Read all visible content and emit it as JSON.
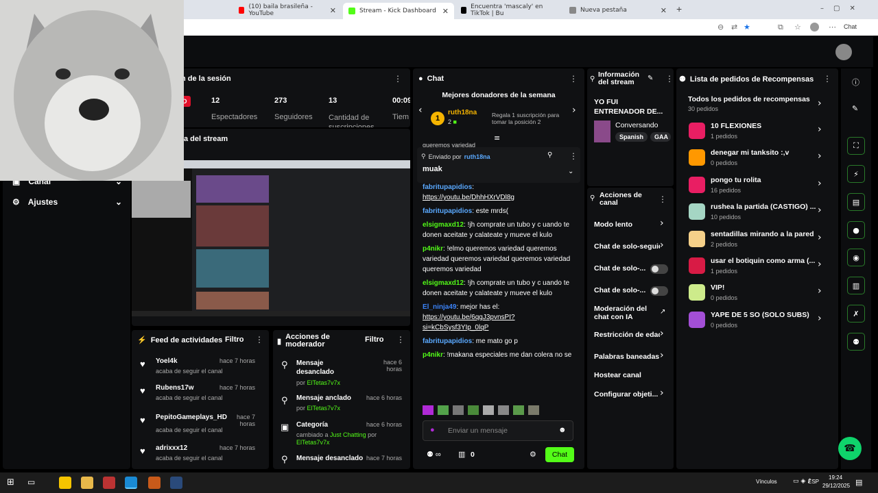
{
  "browser": {
    "tabs": [
      {
        "label": "(10) baila brasileña - YouTube",
        "color": "#ff0000",
        "active": false
      },
      {
        "label": "Stream - Kick Dashboard",
        "color": "#53fc18",
        "active": true
      },
      {
        "label": "Encuentra 'mascaly' en TikTok | Bu",
        "color": "#000000",
        "active": false
      },
      {
        "label": "Nueva pestaña",
        "color": "#888888",
        "active": false
      }
    ],
    "new_tab": "+",
    "chat_button": "Chat"
  },
  "session": {
    "title": "n de la sesión",
    "live_badge": "DO",
    "stats": [
      {
        "value": "12",
        "label": "Espectadores"
      },
      {
        "value": "273",
        "label": "Seguidores"
      },
      {
        "value": "13",
        "label": "Cantidad de suscripciones"
      },
      {
        "value": "00:09",
        "label": "Tiem"
      }
    ]
  },
  "stream_preview": {
    "title": "a del stream"
  },
  "left_nav": {
    "items": [
      {
        "label": "Canal",
        "icon": "channel-icon"
      },
      {
        "label": "Ajustes",
        "icon": "gear-icon"
      }
    ]
  },
  "activity": {
    "title": "Feed de actividades",
    "filter": "Filtro",
    "items": [
      {
        "name": "Yoel4k",
        "time": "hace 7 horas",
        "sub": "acaba de seguir el canal"
      },
      {
        "name": "Rubens17w",
        "time": "hace 7 horas",
        "sub": "acaba de seguir el canal"
      },
      {
        "name": "PepitoGameplays_HD",
        "time": "hace 7 horas",
        "sub": "acaba de seguir el canal"
      },
      {
        "name": "adrixxx12",
        "time": "hace 7 horas",
        "sub": "acaba de seguir el canal"
      }
    ]
  },
  "mod_actions": {
    "title": "Acciones de moderador",
    "filter": "Filtro",
    "items": [
      {
        "title": "Mensaje desanclado",
        "time": "hace 6 horas",
        "by_label": "por",
        "by": "ElTetas7v7x",
        "icon": "unpin-icon"
      },
      {
        "title": "Mensaje anclado",
        "time": "hace 6 horas",
        "by_label": "por",
        "by": "ElTetas7v7x",
        "icon": "pin-icon"
      },
      {
        "title": "Categoría",
        "time": "hace 6 horas",
        "detail": "cambiado a",
        "category": "Just Chatting",
        "by_label": "por",
        "by": "ElTetas7v7x",
        "icon": "category-icon"
      },
      {
        "title": "Mensaje desanclado",
        "time": "hace 7 horas",
        "icon": "unpin-icon"
      }
    ]
  },
  "chat": {
    "title": "Chat",
    "donors_title": "Mejores donadores de la semana",
    "top_donor": {
      "rank": "1",
      "name": "ruth18na",
      "count": "2"
    },
    "next_hint": "Regala 1 suscripción para tomar la posición 2",
    "scroll_text": "queremos variedad",
    "pinned": {
      "label": "Enviado por",
      "user": "ruth18na",
      "message": "muak"
    },
    "messages": [
      {
        "user": "fabritupapidios",
        "color": "#5aa9ff",
        "text": "",
        "link": "https://youtu.be/DhhHXrVDl8g"
      },
      {
        "user": "fabritupapidios",
        "color": "#5aa9ff",
        "text": "este mrds(",
        "link": ""
      },
      {
        "user": "elsigmaxd12",
        "color": "#53fc18",
        "text": "!jh comprate un tubo y c uando te donen aceitate y calateate y mueve el kulo",
        "link": ""
      },
      {
        "user": "p4nikr",
        "color": "#53fc18",
        "text": "!elmo queremos variedad queremos variedad queremos variedad queremos variedad queremos variedad",
        "link": ""
      },
      {
        "user": "elsigmaxd12",
        "color": "#53fc18",
        "text": "!jh comprate un tubo y c uando te donen aceitate y calateate y mueve el kulo",
        "link": ""
      },
      {
        "user": "El_ninja49",
        "color": "#3b82f6",
        "text": "mejor has el:",
        "link": "https://youtu.be/6qgJ3pvnsPI?si=kCbSysf3YIp_0lqP"
      },
      {
        "user": "fabritupapidios",
        "color": "#5aa9ff",
        "text": "me mato go p",
        "link": ""
      },
      {
        "user": "p4nikr",
        "color": "#53fc18",
        "text": "!makana especiales me dan colera no se",
        "link": ""
      }
    ],
    "input_placeholder": "Enviar un mensaje",
    "points": "0",
    "send": "Chat"
  },
  "stream_info": {
    "title": "Información del stream",
    "stream_title": "YO FUI ENTRENADOR DE...",
    "category": "Conversando",
    "tags": [
      "Spanish",
      "GAA"
    ]
  },
  "channel_actions": {
    "title": "Acciones de canal",
    "items": [
      {
        "label": "Modo lento",
        "type": "chevron"
      },
      {
        "label": "Chat de solo-seguid",
        "type": "chevron"
      },
      {
        "label": "Chat de solo-...",
        "type": "toggle"
      },
      {
        "label": "Chat de solo-...",
        "type": "toggle"
      },
      {
        "label": "Moderación del chat con IA",
        "type": "external"
      },
      {
        "label": "Restricción de edad",
        "type": "chevron"
      },
      {
        "label": "Palabras baneadas",
        "type": "chevron"
      },
      {
        "label": "Hostear canal",
        "type": "none"
      },
      {
        "label": "Configurar objeti...",
        "type": "chevron"
      }
    ]
  },
  "rewards": {
    "title": "Lista de pedidos de Recompensas",
    "all": {
      "label": "Todos los pedidos de recompensas",
      "count": "30 pedidos"
    },
    "items": [
      {
        "label": "10 FLEXIONES",
        "count": "1 pedidos",
        "color": "#e91e63"
      },
      {
        "label": "denegar mi tanksito :,v",
        "count": "0 pedidos",
        "color": "#ff9800"
      },
      {
        "label": "pongo tu rolita",
        "count": "16 pedidos",
        "color": "#e91e63"
      },
      {
        "label": "rushea la partida (CASTIGO) ...",
        "count": "10 pedidos",
        "color": "#a5d6c4"
      },
      {
        "label": "sentadillas mirando a la pared",
        "count": "2 pedidos",
        "color": "#f5d089"
      },
      {
        "label": "usar el botiquin como arma (...",
        "count": "1 pedidos",
        "color": "#d81b45"
      },
      {
        "label": "VIP!",
        "count": "0 pedidos",
        "color": "#cdeb8b"
      },
      {
        "label": "YAPE DE 5 SO (SOLO SUBS)",
        "count": "0 pedidos",
        "color": "#a34fd6"
      }
    ]
  },
  "taskbar": {
    "links": "Vínculos",
    "lang": "ESP",
    "time": "19:24",
    "date": "29/12/2025"
  }
}
